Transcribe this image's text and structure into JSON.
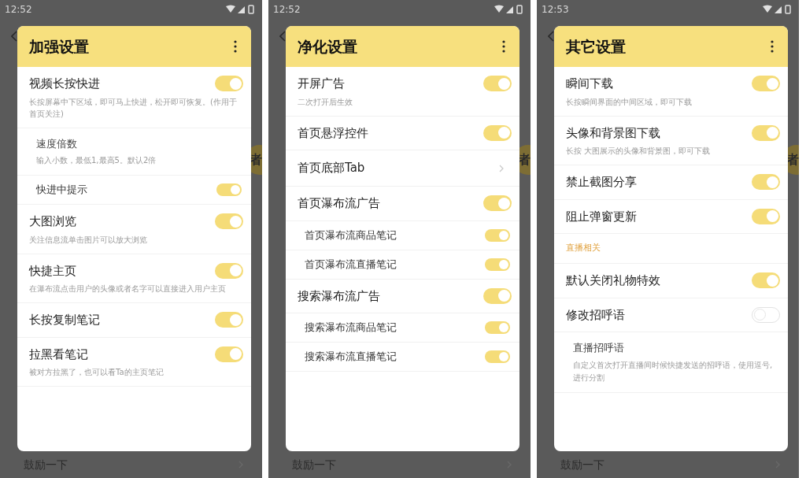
{
  "phones": [
    {
      "time": "12:52",
      "title": "加强设置",
      "badge": "者",
      "footer": "鼓励一下",
      "items": [
        {
          "kind": "toggle",
          "title": "视频长按快进",
          "desc": "长按屏幕中下区域，即可马上快进，松开即可恢复。(作用于首页关注)",
          "on": true
        },
        {
          "kind": "subinput",
          "title": "速度倍数",
          "desc": "输入小数，最低1,最高5。默认2倍"
        },
        {
          "kind": "subtoggle",
          "title": "快进中提示",
          "on": true
        },
        {
          "kind": "toggle",
          "title": "大图浏览",
          "desc": "关注信息流单击图片可以放大浏览",
          "on": true
        },
        {
          "kind": "toggle",
          "title": "快捷主页",
          "desc": "在瀑布流点击用户的头像或者名字可以直接进入用户主页",
          "on": true
        },
        {
          "kind": "toggle",
          "title": "长按复制笔记",
          "on": true
        },
        {
          "kind": "toggle",
          "title": "拉黑看笔记",
          "desc": "被对方拉黑了，也可以看Ta的主页笔记",
          "on": true
        }
      ]
    },
    {
      "time": "12:52",
      "title": "净化设置",
      "badge": "者",
      "footer": "鼓励一下",
      "items": [
        {
          "kind": "toggle",
          "title": "开屏广告",
          "desc": "二次打开后生效",
          "on": true
        },
        {
          "kind": "toggle",
          "title": "首页悬浮控件",
          "on": true
        },
        {
          "kind": "link",
          "title": "首页底部Tab"
        },
        {
          "kind": "toggle",
          "title": "首页瀑布流广告",
          "on": true
        },
        {
          "kind": "subtoggle",
          "title": "首页瀑布流商品笔记",
          "on": true
        },
        {
          "kind": "subtoggle",
          "title": "首页瀑布流直播笔记",
          "on": true
        },
        {
          "kind": "toggle",
          "title": "搜索瀑布流广告",
          "on": true
        },
        {
          "kind": "subtoggle",
          "title": "搜索瀑布流商品笔记",
          "on": true
        },
        {
          "kind": "subtoggle",
          "title": "搜索瀑布流直播笔记",
          "on": true
        }
      ]
    },
    {
      "time": "12:53",
      "title": "其它设置",
      "badge": "者",
      "footer": "鼓励一下",
      "items": [
        {
          "kind": "toggle",
          "title": "瞬间下载",
          "desc": "长按瞬间界面的中间区域，即可下载",
          "on": true
        },
        {
          "kind": "toggle",
          "title": "头像和背景图下载",
          "desc": "长按 大图展示的头像和背景图，即可下载",
          "on": true
        },
        {
          "kind": "toggle",
          "title": "禁止截图分享",
          "on": true
        },
        {
          "kind": "toggle",
          "title": "阻止弹窗更新",
          "on": true
        },
        {
          "kind": "section",
          "title": "直播相关"
        },
        {
          "kind": "toggle",
          "title": "默认关闭礼物特效",
          "on": true
        },
        {
          "kind": "toggle",
          "title": "修改招呼语",
          "on": false
        },
        {
          "kind": "subinput",
          "title": "直播招呼语",
          "desc": "自定义首次打开直播间时候快捷发送的招呼语，使用逗号,进行分割"
        }
      ]
    }
  ]
}
